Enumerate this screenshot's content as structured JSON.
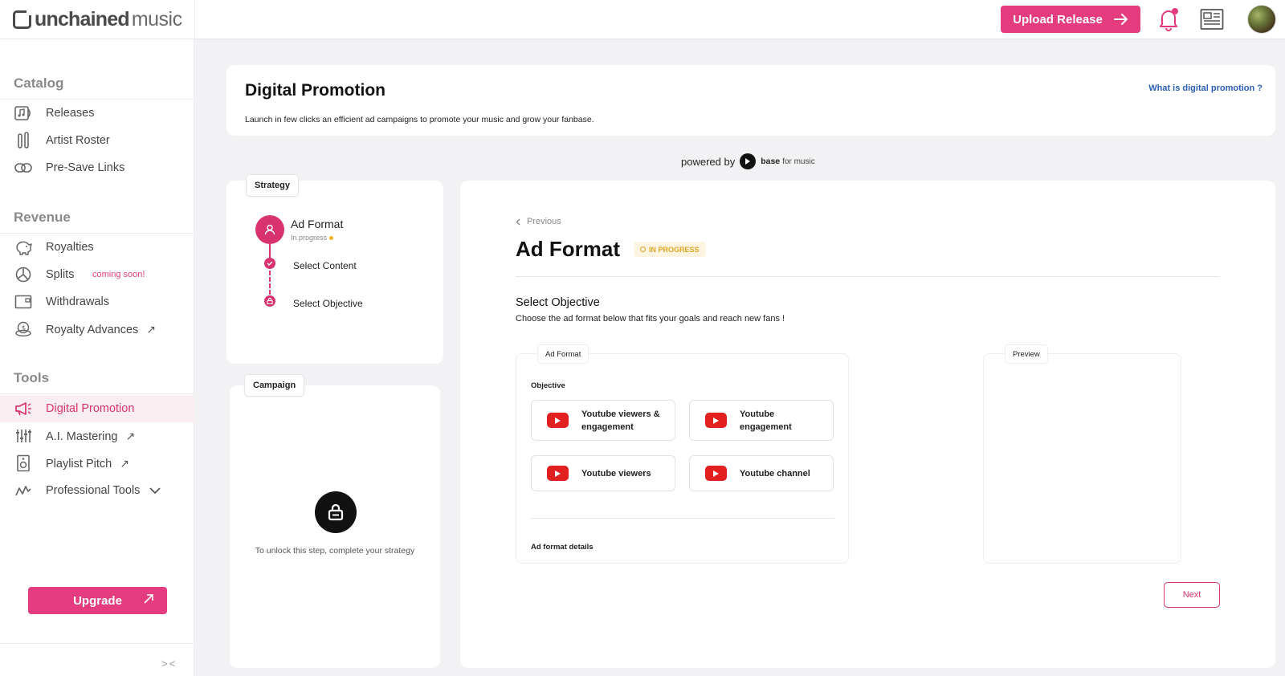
{
  "brand": {
    "name_bold": "unchained",
    "name_light": "music"
  },
  "header": {
    "upload_label": "Upload Release"
  },
  "sidebar": {
    "sections": [
      {
        "title": "Catalog",
        "items": [
          {
            "label": "Releases",
            "icon": "album-icon"
          },
          {
            "label": "Artist Roster",
            "icon": "guitar-icon"
          },
          {
            "label": "Pre-Save Links",
            "icon": "link-icon"
          }
        ]
      },
      {
        "title": "Revenue",
        "items": [
          {
            "label": "Royalties",
            "icon": "piggy-bank-icon"
          },
          {
            "label": "Splits",
            "icon": "pie-chart-icon",
            "badge": "coming soon!"
          },
          {
            "label": "Withdrawals",
            "icon": "wallet-icon"
          },
          {
            "label": "Royalty Advances",
            "icon": "coins-icon",
            "external": true
          }
        ]
      },
      {
        "title": "Tools",
        "items": [
          {
            "label": "Digital Promotion",
            "icon": "megaphone-icon",
            "active": true
          },
          {
            "label": "A.I. Mastering",
            "icon": "sliders-icon",
            "external": true
          },
          {
            "label": "Playlist Pitch",
            "icon": "speaker-icon",
            "external": true
          },
          {
            "label": "Professional Tools",
            "icon": "chart-line-icon",
            "expandable": true
          }
        ]
      }
    ],
    "upgrade_label": "Upgrade"
  },
  "page": {
    "title": "Digital Promotion",
    "subtitle": "Launch in few clicks an efficient ad campaigns to promote your music and grow your fanbase.",
    "help_link": "What is digital promotion ?",
    "powered_by": "powered by",
    "partner_bold": "base",
    "partner_light": "for music"
  },
  "strategy": {
    "tab": "Strategy",
    "step_title": "Ad Format",
    "step_status": "In progress",
    "substeps": [
      "Select Content",
      "Select Objective"
    ]
  },
  "campaign": {
    "tab": "Campaign",
    "locked_text": "To unlock this step, complete your strategy"
  },
  "main": {
    "previous": "Previous",
    "title": "Ad Format",
    "badge": "IN PROGRESS",
    "objective_title": "Select Objective",
    "objective_sub": "Choose the ad format below that fits your goals and reach new fans !",
    "adformat_tab": "Ad Format",
    "preview_tab": "Preview",
    "objective_label": "Objective",
    "options": [
      {
        "line1": "Youtube viewers &",
        "line2": "engagement"
      },
      {
        "line1": "Youtube",
        "line2": "engagement"
      },
      {
        "line1": "Youtube viewers",
        "line2": ""
      },
      {
        "line1": "Youtube channel",
        "line2": ""
      }
    ],
    "details_label": "Ad format details",
    "next_label": "Next"
  },
  "colors": {
    "accent": "#e43c7f",
    "youtube": "#e32020",
    "badge": "#e2a623",
    "link": "#2b5fb8"
  }
}
